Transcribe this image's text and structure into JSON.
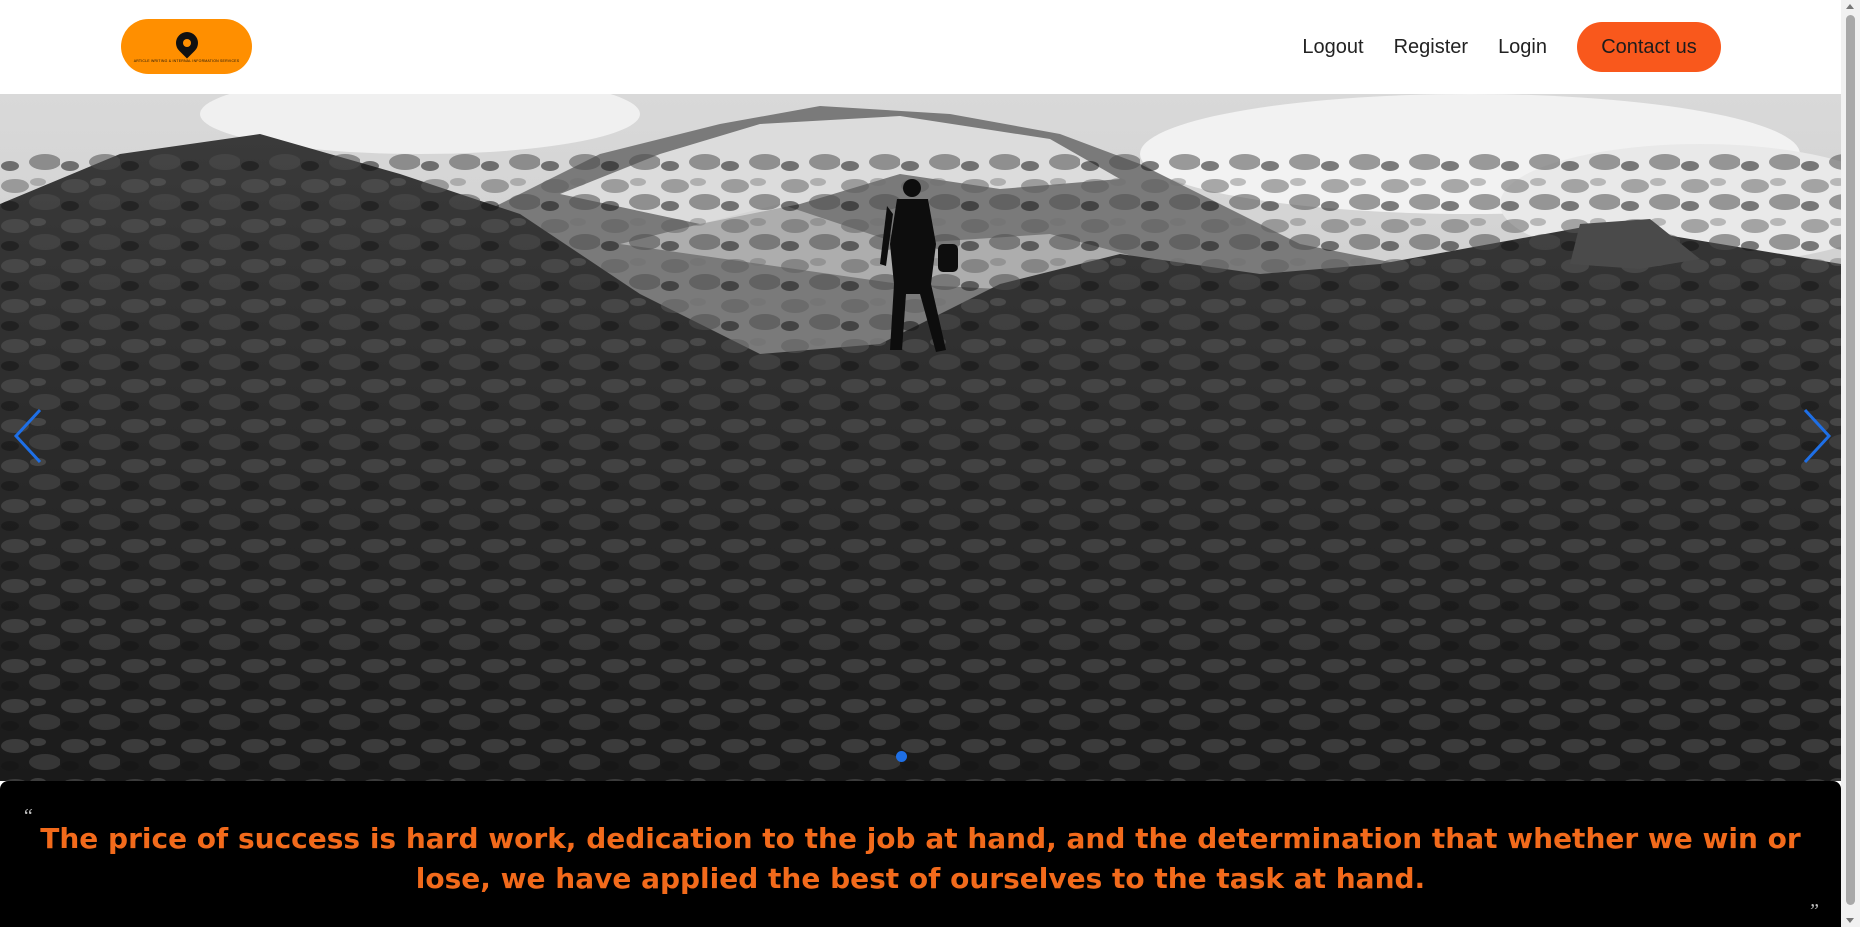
{
  "header": {
    "logo": {
      "icon": "map-pin-icon",
      "tagline": "ARTICLE WRITING & INTERNAL INFORMATION SERVICES",
      "color": "#ff8f00"
    },
    "nav": {
      "logout_label": "Logout",
      "register_label": "Register",
      "login_label": "Login",
      "contact_label": "Contact us",
      "contact_color": "#f9581c"
    }
  },
  "carousel": {
    "image_description": "",
    "prev_icon": "chevron-left-icon",
    "next_icon": "chevron-right-icon",
    "indicator_color": "#1e6fe6",
    "slide_count": 1,
    "active_slide": 1
  },
  "quote": {
    "open_mark": "“",
    "text": "The price of success is hard work, dedication to the job at hand, and the determination that whether we win or lose, we have applied the best of ourselves to the task at hand.",
    "close_mark": "”",
    "color": "#f26a1b"
  }
}
